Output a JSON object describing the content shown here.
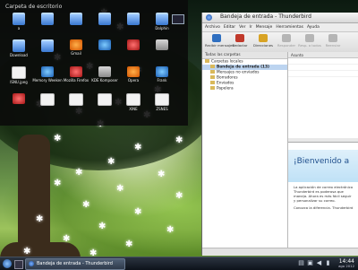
{
  "desktop": {
    "panel_title": "Carpeta de escritorio",
    "icons": [
      {
        "label": "a",
        "kind": "folder"
      },
      {
        "label": "",
        "kind": "folder"
      },
      {
        "label": "",
        "kind": "folder"
      },
      {
        "label": "",
        "kind": "folder"
      },
      {
        "label": "",
        "kind": "folder"
      },
      {
        "label": "Dolphin",
        "kind": "folder"
      },
      {
        "label": "Download",
        "kind": "folder"
      },
      {
        "label": "",
        "kind": "folder"
      },
      {
        "label": "Gmail",
        "kind": "app"
      },
      {
        "label": "",
        "kind": "app"
      },
      {
        "label": "",
        "kind": "app"
      },
      {
        "label": "",
        "kind": "app"
      },
      {
        "label": "ISNU.jpeg",
        "kind": "doc"
      },
      {
        "label": "Memory Weeken",
        "kind": "app"
      },
      {
        "label": "Mozilla Firefox",
        "kind": "app"
      },
      {
        "label": "KDE Komposer",
        "kind": "app"
      },
      {
        "label": "Opera",
        "kind": "app"
      },
      {
        "label": "Frank",
        "kind": "app"
      },
      {
        "label": "",
        "kind": "app"
      },
      {
        "label": "",
        "kind": "doc"
      },
      {
        "label": "",
        "kind": "doc"
      },
      {
        "label": "",
        "kind": "doc"
      },
      {
        "label": "XINE",
        "kind": "doc"
      },
      {
        "label": "ZSNES",
        "kind": "doc"
      }
    ]
  },
  "thunderbird": {
    "window_title": "Bandeja de entrada - Thunderbird",
    "menu": [
      "Archivo",
      "Editar",
      "Ver",
      "Ir",
      "Mensaje",
      "Herramientas",
      "Ayuda"
    ],
    "toolbar": [
      {
        "label": "Recibir mensajes",
        "icon": "get-mail-icon",
        "enabled": true
      },
      {
        "label": "Redactar",
        "icon": "compose-icon",
        "enabled": true
      },
      {
        "label": "Direcciones",
        "icon": "address-book-icon",
        "enabled": true
      },
      {
        "label": "Responder",
        "icon": "reply-icon",
        "enabled": false
      },
      {
        "label": "Resp. a todos",
        "icon": "reply-all-icon",
        "enabled": false
      },
      {
        "label": "Reenviar",
        "icon": "forward-icon",
        "enabled": false
      }
    ],
    "folder_pane_header": "Todas las carpetas",
    "folders": [
      {
        "label": "Carpetas locales",
        "selected": false,
        "indent": 0
      },
      {
        "label": "Bandeja de entrada (13)",
        "selected": true,
        "indent": 1
      },
      {
        "label": "Mensajes no enviados",
        "selected": false,
        "indent": 1
      },
      {
        "label": "Borradores",
        "selected": false,
        "indent": 1
      },
      {
        "label": "Enviados",
        "selected": false,
        "indent": 1
      },
      {
        "label": "Papelera",
        "selected": false,
        "indent": 1
      }
    ],
    "columns": {
      "subject": "Asunto"
    },
    "welcome": {
      "heading": "¡Bienvenido a",
      "paragraph1": "La aplicación de correo electrónico Thunderbird es poderosa que maneja. Ahora es más fácil seguir y personalizar su correo.",
      "paragraph2": "Conozca la diferencia. Thunderbird"
    }
  },
  "taskbar": {
    "task_title": "Bandeja de entrada - Thunderbird",
    "time": "14:44",
    "date": "ago 2012"
  }
}
